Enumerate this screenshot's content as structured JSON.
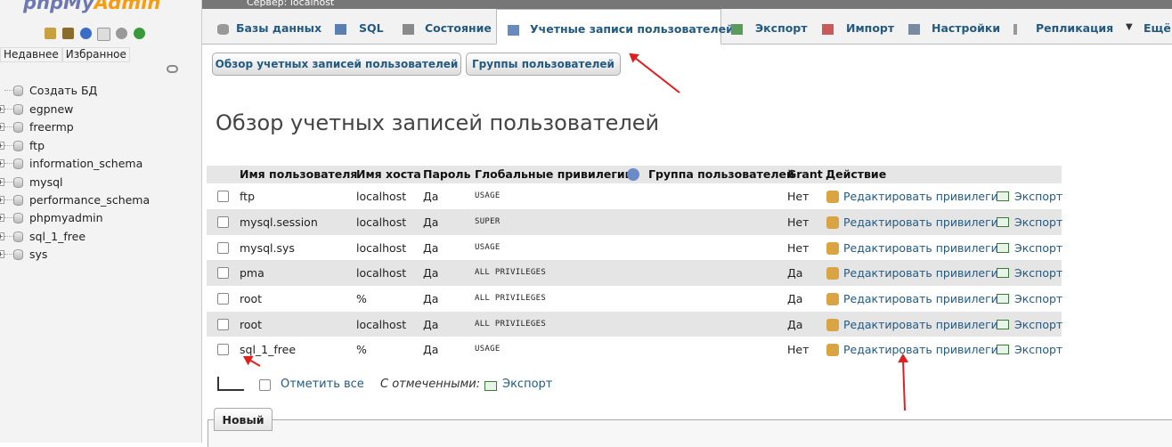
{
  "sidebar": {
    "logo_php": "php",
    "logo_my": "My",
    "logo_admin": "Admin",
    "tabs": [
      "Недавнее",
      "Избранное"
    ],
    "new_db": "Создать БД",
    "databases": [
      "egpnew",
      "freermp",
      "ftp",
      "information_schema",
      "mysql",
      "performance_schema",
      "phpmyadmin",
      "sql_1_free",
      "sys"
    ]
  },
  "serverbar": {
    "title": "Сервер: localhost"
  },
  "menu": {
    "tabs": [
      {
        "label": "Базы данных",
        "icon": "database-icon"
      },
      {
        "label": "SQL",
        "icon": "sql-icon"
      },
      {
        "label": "Состояние",
        "icon": "status-icon"
      },
      {
        "label": "Учетные записи пользователей",
        "icon": "users-icon"
      },
      {
        "label": "Экспорт",
        "icon": "export-icon"
      },
      {
        "label": "Импорт",
        "icon": "import-icon"
      },
      {
        "label": "Настройки",
        "icon": "wrench-icon"
      },
      {
        "label": "Репликация",
        "icon": "replication-icon"
      },
      {
        "label": "Ещё",
        "icon": "chevron-down-icon"
      }
    ]
  },
  "subtabs": [
    "Обзор учетных записей пользователей",
    "Группы пользователей"
  ],
  "heading": "Обзор учетных записей пользователей",
  "table": {
    "headers": [
      "Имя пользователя",
      "Имя хоста",
      "Пароль",
      "Глобальные привилегии",
      "Группа пользователей",
      "Grant",
      "Действие"
    ],
    "rows": [
      {
        "user": "ftp",
        "host": "localhost",
        "password": "Да",
        "privileges": "USAGE",
        "group": "",
        "grant": "Нет"
      },
      {
        "user": "mysql.session",
        "host": "localhost",
        "password": "Да",
        "privileges": "SUPER",
        "group": "",
        "grant": "Нет"
      },
      {
        "user": "mysql.sys",
        "host": "localhost",
        "password": "Да",
        "privileges": "USAGE",
        "group": "",
        "grant": "Нет"
      },
      {
        "user": "pma",
        "host": "localhost",
        "password": "Да",
        "privileges": "ALL PRIVILEGES",
        "group": "",
        "grant": "Да"
      },
      {
        "user": "root",
        "host": "%",
        "password": "Да",
        "privileges": "ALL PRIVILEGES",
        "group": "",
        "grant": "Да"
      },
      {
        "user": "root",
        "host": "localhost",
        "password": "Да",
        "privileges": "ALL PRIVILEGES",
        "group": "",
        "grant": "Да"
      },
      {
        "user": "sql_1_free",
        "host": "%",
        "password": "Да",
        "privileges": "USAGE",
        "group": "",
        "grant": "Нет"
      }
    ],
    "edit_label": "Редактировать привилегии",
    "export_label": "Экспорт"
  },
  "footer": {
    "check_all": "Отметить все",
    "with_selected": "С отмеченными:",
    "export": "Экспорт"
  },
  "new_section": {
    "title": "Новый"
  },
  "colors": {
    "link": "#235a81",
    "annotation": "#e02020"
  }
}
